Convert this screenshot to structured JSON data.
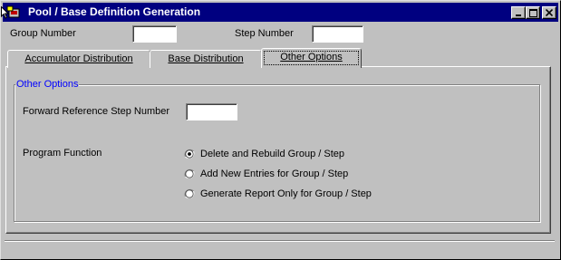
{
  "window": {
    "title": "Pool / Base Definition Generation"
  },
  "header": {
    "group_number_label": "Group Number",
    "group_number_value": "",
    "step_number_label": "Step Number",
    "step_number_value": ""
  },
  "tabs": [
    {
      "label": "Accumulator Distribution",
      "active": false
    },
    {
      "label": "Base Distribution",
      "active": false
    },
    {
      "label": "Other Options",
      "active": true
    }
  ],
  "other_options": {
    "group_title": "Other Options",
    "forward_ref_label": "Forward Reference Step Number",
    "forward_ref_value": "",
    "program_function_label": "Program Function",
    "radios": [
      {
        "label": "Delete and Rebuild Group / Step",
        "selected": true
      },
      {
        "label": "Add New Entries for Group / Step",
        "selected": false
      },
      {
        "label": "Generate Report Only for Group / Step",
        "selected": false
      }
    ]
  },
  "colors": {
    "titlebar": "#000080",
    "group_title": "#0000ff",
    "face": "#c0c0c0"
  },
  "icons": [
    "app-icon",
    "minimize-icon",
    "maximize-icon",
    "close-icon",
    "mouse-pointer-icon"
  ]
}
